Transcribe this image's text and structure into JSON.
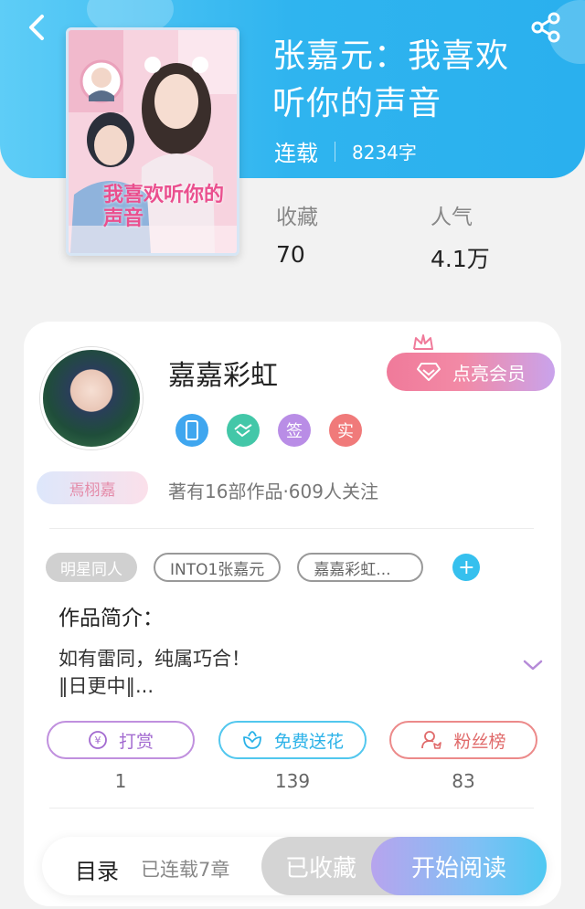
{
  "header": {
    "back_icon": "chevron-left-icon",
    "share_icon": "share-icon"
  },
  "book": {
    "title": "张嘉元：我喜欢听你的声音",
    "title_line1": "张嘉元：我喜欢",
    "title_line2": "听你的声音",
    "status": "连载",
    "word_count": "8234字",
    "cover_text": "我喜欢听你的声音"
  },
  "stats": {
    "favorites_label": "收藏",
    "favorites_value": "70",
    "popularity_label": "人气",
    "popularity_value": "4.1万"
  },
  "author": {
    "name": "嘉嘉彩虹",
    "vip_button_label": "点亮会员",
    "badges": [
      {
        "icon": "phone-icon",
        "color": "#3fa6ef"
      },
      {
        "icon": "handshake-icon",
        "color": "#43c7a8"
      },
      {
        "text": "签",
        "color": "#b98de6"
      },
      {
        "text": "实",
        "color": "#f07a7a"
      }
    ],
    "nickname": "焉栩嘉",
    "meta": "著有16部作品·609人关注"
  },
  "tags": [
    "明星同人",
    "INTO1张嘉元",
    "嘉嘉彩虹..."
  ],
  "intro": {
    "title": "作品简介：",
    "line1": "如有雷同，纯属巧合！",
    "line2": "‖日更中‖..."
  },
  "actions": [
    {
      "label": "打赏",
      "count": "1",
      "icon": "coin-icon"
    },
    {
      "label": "免费送花",
      "count": "139",
      "icon": "flower-icon"
    },
    {
      "label": "粉丝榜",
      "count": "83",
      "icon": "fans-icon"
    }
  ],
  "bottom": {
    "toc_label": "目录",
    "chapters": "已连载7章",
    "favorited_label": "已收藏",
    "read_label": "开始阅读"
  }
}
